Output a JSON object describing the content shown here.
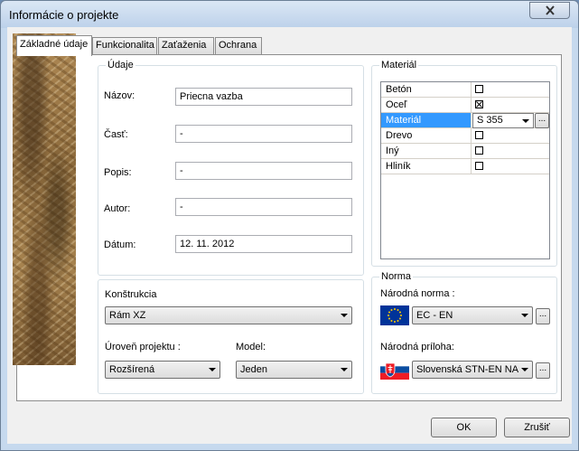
{
  "window": {
    "title": "Informácie o projekte"
  },
  "tabs": [
    {
      "label": "Základné údaje",
      "active": true
    },
    {
      "label": "Funkcionalita",
      "active": false
    },
    {
      "label": "Zaťaženia",
      "active": false
    },
    {
      "label": "Ochrana",
      "active": false
    }
  ],
  "udaje": {
    "title": "Údaje",
    "fields": [
      {
        "label": "Názov:",
        "value": "Priecna vazba"
      },
      {
        "label": "Časť:",
        "value": "-"
      },
      {
        "label": "Popis:",
        "value": "-"
      },
      {
        "label": "Autor:",
        "value": "-"
      },
      {
        "label": "Dátum:",
        "value": "12. 11. 2012"
      }
    ]
  },
  "konstrukcia": {
    "label": "Konštrukcia",
    "value": "Rám XZ",
    "uroven_label": "Úroveň projektu :",
    "uroven_value": "Rozšírená",
    "model_label": "Model:",
    "model_value": "Jeden"
  },
  "material": {
    "title": "Materiál",
    "rows": [
      {
        "name": "Betón",
        "checked": false
      },
      {
        "name": "Oceľ",
        "checked": true
      },
      {
        "name": "Materiál",
        "value": "S 355",
        "selected": true
      },
      {
        "name": "Drevo",
        "checked": false
      },
      {
        "name": "Iný",
        "checked": false
      },
      {
        "name": "Hliník",
        "checked": false
      }
    ],
    "browse_label": "..."
  },
  "norma": {
    "title": "Norma",
    "narodna_norma_label": "Národná norma :",
    "narodna_norma_value": "EC - EN",
    "narodna_priloha_label": "Národná príloha:",
    "narodna_priloha_value": "Slovenská STN-EN NA",
    "browse_label": "..."
  },
  "buttons": {
    "ok": "OK",
    "cancel": "Zrušiť"
  },
  "colors": {
    "selection": "#3399ff",
    "eu_blue": "#003399",
    "eu_gold": "#ffcc00"
  }
}
